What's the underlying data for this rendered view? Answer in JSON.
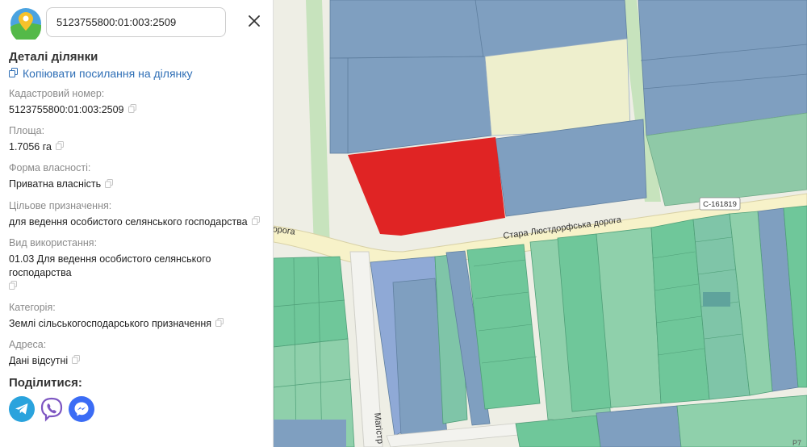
{
  "search": {
    "value": "5123755800:01:003:2509"
  },
  "details": {
    "title": "Деталі ділянки",
    "copy_link": "Копіювати посилання на ділянку",
    "fields": [
      {
        "label": "Кадастровий номер:",
        "value": "5123755800:01:003:2509"
      },
      {
        "label": "Площа:",
        "value": "1.7056 га"
      },
      {
        "label": "Форма власності:",
        "value": "Приватна власність"
      },
      {
        "label": "Цільове призначення:",
        "value": "для ведення особистого селянського господарства"
      },
      {
        "label": "Вид використання:",
        "value": "01.03 Для ведення особистого селянського господарства"
      },
      {
        "label": "Категорія:",
        "value": "Землі сільськогосподарського призначення"
      },
      {
        "label": "Адреса:",
        "value": "Дані відсутні"
      }
    ],
    "share_title": "Поділитися:",
    "share_buttons": [
      {
        "name": "telegram",
        "icon": "telegram-icon",
        "color": "#2aa3dd"
      },
      {
        "name": "viber",
        "icon": "viber-icon",
        "color": "#7d56c2"
      },
      {
        "name": "messenger",
        "icon": "messenger-icon",
        "color": "#3b6cf5"
      }
    ]
  },
  "map": {
    "road_main": "Стара Люстдорфська дорога",
    "road_left_fragment": "орога",
    "road_code": "С-161819",
    "road_vertical": "Магістр",
    "corner_label": "Р7",
    "colors": {
      "selected_parcel": "#e02424",
      "private_parcel": "#7f9fc0",
      "agri_parcel": "#6fc79a",
      "base": "#eeeee5",
      "road": "#f7f2c9"
    }
  }
}
